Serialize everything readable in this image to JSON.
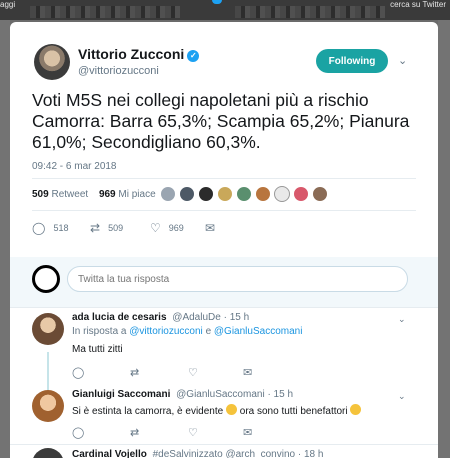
{
  "topbar": {
    "left_text": "aggi",
    "right_text": "cerca su Twitter"
  },
  "tweet": {
    "author_name": "Vittorio Zucconi",
    "author_handle": "@vittoriozucconi",
    "follow_label": "Following",
    "text": "Voti M5S nei collegi napoletani più a rischio Camorra: Barra 65,3%; Scampia 65,2%; Pianura 61,0%; Secondigliano 60,3%.",
    "timestamp": "09:42 - 6 mar 2018",
    "retweets_count": "509",
    "retweets_label": "Retweet",
    "likes_count": "969",
    "likes_label": "Mi piace",
    "actions": {
      "replies": "518",
      "retweets": "509",
      "likes": "969"
    }
  },
  "reply_box": {
    "placeholder": "Twitta la tua risposta"
  },
  "replies": [
    {
      "name": "ada lucia de cesaris",
      "handle": "@AdaluDe",
      "time": "· 15 h",
      "in_reply_prefix": "In risposta a",
      "in_reply_user1": "@vittoriozucconi",
      "in_reply_and": "e",
      "in_reply_user2": "@GianluSaccomani",
      "text": "Ma tutti zitti"
    },
    {
      "name": "Gianluigi Saccomani",
      "handle": "@GianluSaccomani",
      "time": "· 15 h",
      "text_part1": "Si è estinta la camorra, è evidente",
      "text_part2": "ora sono tutti benefattori"
    },
    {
      "name": "Cardinal Vojello",
      "handle": "#deSalvinizzato @arch_convino",
      "time": "· 18 h"
    }
  ],
  "colors": {
    "follow_button": "#1aa3a3",
    "link": "#1b95e0",
    "verified": "#1da1f2"
  }
}
